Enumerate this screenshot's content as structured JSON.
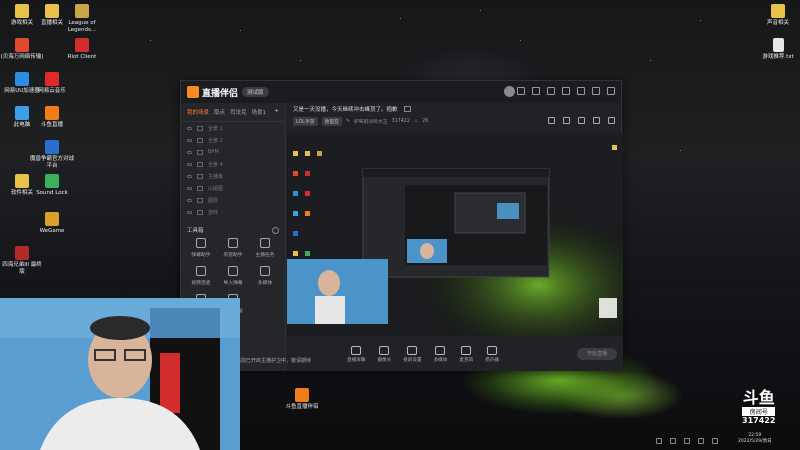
{
  "desktop": {
    "icons_left": [
      {
        "label": "游戏相关",
        "icon": "folder-icon",
        "color": "#e8c14a"
      },
      {
        "label": "直播相关",
        "icon": "folder-icon",
        "color": "#e8c14a"
      },
      {
        "label": "League of Legends...",
        "icon": "league-of-legends-icon",
        "color": "#c9a548"
      },
      {
        "label": "(贝海万网络传输)",
        "icon": "app-icon",
        "color": "#e0482f"
      },
      {
        "label": "Riot Client",
        "icon": "riot-client-icon",
        "color": "#d22d2d"
      },
      {
        "label": "网易UU加速器",
        "icon": "uu-accelerator-icon",
        "color": "#2a8fe0"
      },
      {
        "label": "网易云音乐",
        "icon": "netease-music-icon",
        "color": "#e02a2a"
      },
      {
        "label": "此电脑",
        "icon": "this-pc-icon",
        "color": "#3aa0e8"
      },
      {
        "label": "斗鱼直播",
        "icon": "douyu-live-icon",
        "color": "#f07d1a"
      },
      {
        "label": "魔兽争霸官方对战平台",
        "icon": "warcraft-platform-icon",
        "color": "#2a6fd0"
      },
      {
        "label": "软件相关",
        "icon": "folder-icon",
        "color": "#e8c14a"
      },
      {
        "label": "Sound Lock",
        "icon": "sound-lock-icon",
        "color": "#3ab05a"
      },
      {
        "label": "WeGame",
        "icon": "wegame-icon",
        "color": "#d7a02c"
      },
      {
        "label": "四海兄弟III 最终版",
        "icon": "mafia-game-icon",
        "color": "#b22a2a"
      }
    ],
    "icons_right": [
      {
        "label": "声音相关",
        "icon": "folder-icon",
        "color": "#e8c14a"
      },
      {
        "label": "游戏推荐.txt",
        "icon": "text-file-icon",
        "color": "#e6e6e6"
      }
    ],
    "center_icon": {
      "label": "斗鱼直播伴侣",
      "icon": "douyu-companion-icon",
      "color": "#f07d1a"
    }
  },
  "window": {
    "app_name": "直播伴侣",
    "version": "测试版",
    "left_tabs": [
      "我的场景",
      "取点",
      "司法克",
      "场景1"
    ],
    "scenes": [
      {
        "name": "全景 1"
      },
      {
        "name": "全景 2"
      },
      {
        "name": "BPM"
      },
      {
        "name": "全景 4"
      },
      {
        "name": "主播像"
      },
      {
        "name": "山屋图"
      },
      {
        "name": "图层"
      },
      {
        "name": "游戏"
      }
    ],
    "tools_title": "工具箱",
    "tools": [
      {
        "label": "弹幕助手",
        "icon": "danmu-icon"
      },
      {
        "label": "房管助手",
        "icon": "user-icon"
      },
      {
        "label": "主播任务",
        "icon": "task-icon"
      },
      {
        "label": "视频连麦",
        "icon": "link-mic-icon"
      },
      {
        "label": "导入弹幕",
        "icon": "download-icon"
      },
      {
        "label": "多媒体",
        "icon": "media-icon"
      },
      {
        "label": "答问助手",
        "icon": "qa-icon"
      },
      {
        "label": "直播数据",
        "icon": "stats-icon"
      }
    ],
    "stream": {
      "title": "又是一天没播，今天继续冲击峰顶了。抱歉",
      "category_1": "LOL手游",
      "category_2": "德里亚",
      "room_name": "护驾的冷鸡大王",
      "room_number": "317422",
      "heat": "26"
    },
    "controls": [
      {
        "label": "直播屏幕",
        "icon": "screen-icon"
      },
      {
        "label": "摄像头",
        "icon": "camera-icon"
      },
      {
        "label": "投屏设置",
        "icon": "cast-icon"
      },
      {
        "label": "多媒体",
        "icon": "media-icon"
      },
      {
        "label": "麦克风",
        "icon": "mic-icon"
      },
      {
        "label": "扬声器",
        "icon": "speaker-icon"
      }
    ],
    "go_live": "开始直播",
    "hint": "当前已开启主播护卫中，敬请期待"
  },
  "overlay": {
    "platform": "斗鱼",
    "room_label": "房间号",
    "room_number": "317422"
  },
  "clock": {
    "time": "22:59",
    "date": "2022/5/29/周日"
  }
}
